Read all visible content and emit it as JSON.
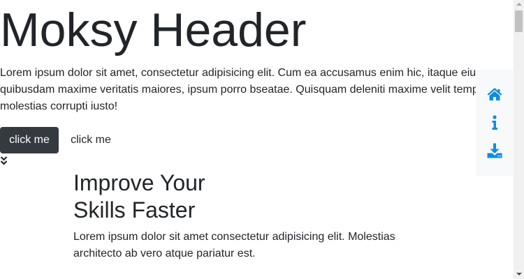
{
  "hero": {
    "title": "Moksy Header",
    "text": "Lorem ipsum dolor sit amet, consectetur adipisicing elit. Cum ea accusamus enim hic, itaque eius quibusdam maxime veritatis maiores, ipsum porro bseatae. Quisquam deleniti maxime velit tempore molestias corrupti iusto!",
    "primary_button": "click me",
    "secondary_button": "click me",
    "scroll_icon": "double-chevron-down-icon"
  },
  "section": {
    "title_line1": "Improve Your",
    "title_line2": "Skills Faster",
    "text": "Lorem ipsum dolor sit amet consectetur adipisicing elit. Molestias architecto ab vero atque pariatur est."
  },
  "side_nav": {
    "items": [
      {
        "icon": "home-icon"
      },
      {
        "icon": "info-icon"
      },
      {
        "icon": "download-icon"
      }
    ],
    "icon_color": "#0d8de0"
  },
  "colors": {
    "text": "#212529",
    "primary_button_bg": "#343a40",
    "side_nav_bg": "#f8f9fa"
  }
}
